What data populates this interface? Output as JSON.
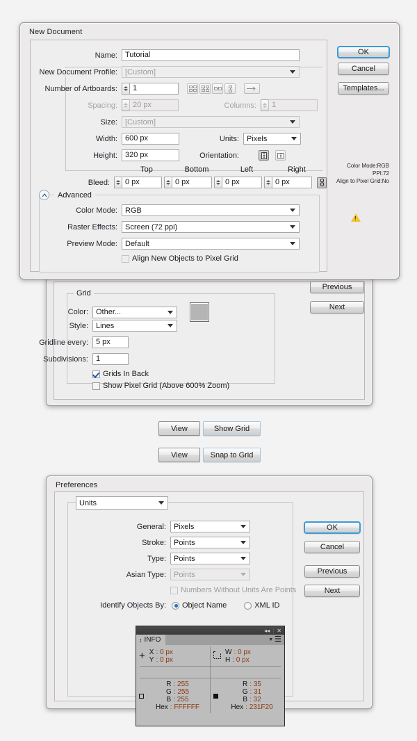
{
  "new_document": {
    "title": "New Document",
    "fields": {
      "name_label": "Name:",
      "name_value": "Tutorial",
      "profile_label": "New Document Profile:",
      "profile_value": "[Custom]",
      "artboards_label": "Number of Artboards:",
      "artboards_value": "1",
      "spacing_label": "Spacing:",
      "spacing_value": "20 px",
      "columns_label": "Columns:",
      "columns_value": "1",
      "size_label": "Size:",
      "size_value": "[Custom]",
      "width_label": "Width:",
      "width_value": "600 px",
      "height_label": "Height:",
      "height_value": "320 px",
      "units_label": "Units:",
      "units_value": "Pixels",
      "orientation_label": "Orientation:",
      "bleed_label": "Bleed:",
      "bleed_top_header": "Top",
      "bleed_bottom_header": "Bottom",
      "bleed_left_header": "Left",
      "bleed_right_header": "Right",
      "bleed_top": "0 px",
      "bleed_bottom": "0 px",
      "bleed_left": "0 px",
      "bleed_right": "0 px"
    },
    "advanced": {
      "legend": "Advanced",
      "color_mode_label": "Color Mode:",
      "color_mode_value": "RGB",
      "raster_label": "Raster Effects:",
      "raster_value": "Screen (72 ppi)",
      "preview_label": "Preview Mode:",
      "preview_value": "Default",
      "align_checkbox_label": "Align New Objects to Pixel Grid",
      "align_checked": false
    },
    "buttons": {
      "ok": "OK",
      "cancel": "Cancel",
      "templates": "Templates..."
    },
    "summary": [
      "Color Mode:RGB",
      "PPI:72",
      "Align to Pixel Grid:No"
    ]
  },
  "grid_prefs": {
    "legend": "Grid",
    "color_label": "Color:",
    "color_value": "Other...",
    "color_swatch": "#b5b5b5",
    "style_label": "Style:",
    "style_value": "Lines",
    "gridline_label": "Gridline every:",
    "gridline_value": "5 px",
    "subdivisions_label": "Subdivisions:",
    "subdivisions_value": "1",
    "grids_in_back_label": "Grids In Back",
    "grids_in_back_checked": true,
    "show_pixel_grid_label": "Show Pixel Grid (Above 600% Zoom)",
    "show_pixel_grid_checked": false,
    "buttons": {
      "previous": "Previous",
      "next": "Next"
    }
  },
  "menu_steps": [
    {
      "menu": "View",
      "item": "Show Grid"
    },
    {
      "menu": "View",
      "item": "Snap to Grid"
    }
  ],
  "preferences": {
    "title": "Preferences",
    "section_value": "Units",
    "rows": [
      {
        "label": "General:",
        "value": "Pixels",
        "disabled": false
      },
      {
        "label": "Stroke:",
        "value": "Points",
        "disabled": false
      },
      {
        "label": "Type:",
        "value": "Points",
        "disabled": false
      },
      {
        "label": "Asian Type:",
        "value": "Points",
        "disabled": true
      }
    ],
    "numbers_checkbox_label": "Numbers Without Units Are Points",
    "numbers_checked": false,
    "identify_label": "Identify Objects By:",
    "identify_options": [
      {
        "label": "Object Name",
        "selected": true
      },
      {
        "label": "XML ID",
        "selected": false
      }
    ],
    "buttons": {
      "ok": "OK",
      "cancel": "Cancel",
      "previous": "Previous",
      "next": "Next"
    }
  },
  "info_panel": {
    "tab_label": "INFO",
    "position": {
      "x_label": "X",
      "x_value": ": 0 px",
      "y_label": "Y",
      "y_value": ": 0 px"
    },
    "dimensions": {
      "w_label": "W",
      "w_value": ": 0 px",
      "h_label": "H",
      "h_value": ": 0 px"
    },
    "fill": {
      "r_label": "R",
      "r_value": ": 255",
      "g_label": "G",
      "g_value": ": 255",
      "b_label": "B",
      "b_value": ": 255",
      "hex_label": "Hex",
      "hex_value": ": FFFFFF"
    },
    "stroke": {
      "r_label": "R",
      "r_value": ": 35",
      "g_label": "G",
      "g_value": ": 31",
      "b_label": "B",
      "b_value": ": 32",
      "hex_label": "Hex",
      "hex_value": ": 231F20"
    }
  },
  "colors": {
    "accent": "#3c9ada",
    "dialog_bg": "#eceaea",
    "panel_dark": "#3a3a3a",
    "panel_body": "#bdbdbd",
    "warning": "#f2c430"
  }
}
